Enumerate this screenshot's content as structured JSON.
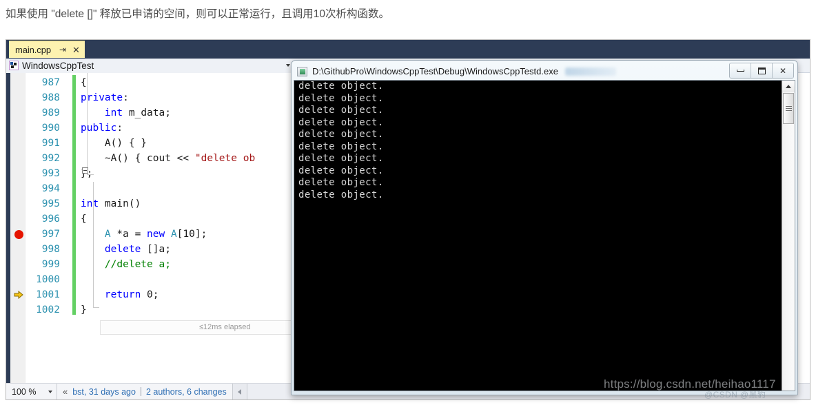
{
  "caption": "如果使用 \"delete []\" 释放已申请的空间，则可以正常运行，且调用10次析构函数。",
  "ide": {
    "tab": {
      "label": "main.cpp",
      "pin_icon": "pin-icon",
      "close_icon": "close-icon"
    },
    "navbar": {
      "project_icon": "project-icon",
      "project": "WindowsCppTest",
      "caret_icon": "chevron-down-icon"
    },
    "editor": {
      "elapsed_label": "≤12ms elapsed",
      "breakpoint_line": 997,
      "current_line": 1001,
      "lines": [
        {
          "num": "987",
          "glyph": "",
          "tokens": [
            {
              "t": "{",
              "c": "t-plain"
            }
          ]
        },
        {
          "num": "988",
          "glyph": "",
          "tokens": [
            {
              "t": "private",
              "c": "t-kw"
            },
            {
              "t": ":",
              "c": "t-plain"
            }
          ]
        },
        {
          "num": "989",
          "glyph": "",
          "tokens": [
            {
              "t": "    ",
              "c": "t-plain"
            },
            {
              "t": "int",
              "c": "t-kw"
            },
            {
              "t": " m_data;",
              "c": "t-plain"
            }
          ]
        },
        {
          "num": "990",
          "glyph": "",
          "tokens": [
            {
              "t": "public",
              "c": "t-kw"
            },
            {
              "t": ":",
              "c": "t-plain"
            }
          ]
        },
        {
          "num": "991",
          "glyph": "",
          "tokens": [
            {
              "t": "    A() { }",
              "c": "t-plain"
            }
          ]
        },
        {
          "num": "992",
          "glyph": "",
          "tokens": [
            {
              "t": "    ~A() { ",
              "c": "t-plain"
            },
            {
              "t": "cout",
              "c": "t-plain"
            },
            {
              "t": " << ",
              "c": "t-op"
            },
            {
              "t": "\"delete ob",
              "c": "t-str"
            }
          ]
        },
        {
          "num": "993",
          "glyph": "",
          "tokens": [
            {
              "t": "};",
              "c": "t-plain"
            }
          ]
        },
        {
          "num": "994",
          "glyph": "",
          "tokens": [
            {
              "t": "",
              "c": "t-plain"
            }
          ]
        },
        {
          "num": "995",
          "glyph": "",
          "tokens": [
            {
              "t": "int",
              "c": "t-kw"
            },
            {
              "t": " main()",
              "c": "t-plain"
            }
          ]
        },
        {
          "num": "996",
          "glyph": "",
          "tokens": [
            {
              "t": "{",
              "c": "t-plain"
            }
          ]
        },
        {
          "num": "997",
          "glyph": "breakpoint",
          "tokens": [
            {
              "t": "    ",
              "c": "t-plain"
            },
            {
              "t": "A",
              "c": "t-type"
            },
            {
              "t": " *a = ",
              "c": "t-plain"
            },
            {
              "t": "new",
              "c": "t-kw"
            },
            {
              "t": " ",
              "c": "t-plain"
            },
            {
              "t": "A",
              "c": "t-type"
            },
            {
              "t": "[",
              "c": "t-plain"
            },
            {
              "t": "10",
              "c": "t-plain"
            },
            {
              "t": "];",
              "c": "t-plain"
            }
          ]
        },
        {
          "num": "998",
          "glyph": "",
          "tokens": [
            {
              "t": "    ",
              "c": "t-plain"
            },
            {
              "t": "delete",
              "c": "t-kw"
            },
            {
              "t": " []a;",
              "c": "t-plain"
            }
          ]
        },
        {
          "num": "999",
          "glyph": "",
          "tokens": [
            {
              "t": "    //delete a;",
              "c": "t-cmt"
            }
          ]
        },
        {
          "num": "1000",
          "glyph": "",
          "tokens": [
            {
              "t": "",
              "c": "t-plain"
            }
          ]
        },
        {
          "num": "1001",
          "glyph": "current",
          "tokens": [
            {
              "t": "    ",
              "c": "t-plain"
            },
            {
              "t": "return",
              "c": "t-kw"
            },
            {
              "t": " ",
              "c": "t-plain"
            },
            {
              "t": "0",
              "c": "t-plain"
            },
            {
              "t": ";",
              "c": "t-plain"
            }
          ]
        },
        {
          "num": "1002",
          "glyph": "",
          "tokens": [
            {
              "t": "}",
              "c": "t-plain"
            }
          ]
        }
      ]
    },
    "statusbar": {
      "zoom": "100 %",
      "zoom_caret_icon": "chevron-down-icon",
      "codelens_chevron_icon": "double-chevron-left-icon",
      "author_info": "bst, 31 days ago",
      "change_info": "2 authors, 6 changes",
      "scroll_left_icon": "triangle-left-icon"
    }
  },
  "console": {
    "icon": "console-app-icon",
    "title": "D:\\GithubPro\\WindowsCppTest\\Debug\\WindowsCppTestd.exe",
    "buttons": {
      "minimize": "minimize-icon",
      "maximize": "maximize-icon",
      "close": "✕"
    },
    "output_line": "delete object.",
    "output_count": 10,
    "scrollbar": {
      "up_icon": "triangle-up-icon",
      "thumb": "scroll-thumb"
    }
  },
  "watermarks": {
    "url": "https://blog.csdn.net/heihao1117",
    "badge": "@CSDN @黑豹"
  },
  "colors": {
    "vs_titlebar": "#2d3c56",
    "tab_active": "#fdf2b0",
    "keyword": "#0000ff",
    "string": "#a31515",
    "comment": "#008000",
    "type": "#2b91af",
    "breakpoint": "#e51400",
    "changebar": "#63d063",
    "link": "#2f6fb4"
  }
}
